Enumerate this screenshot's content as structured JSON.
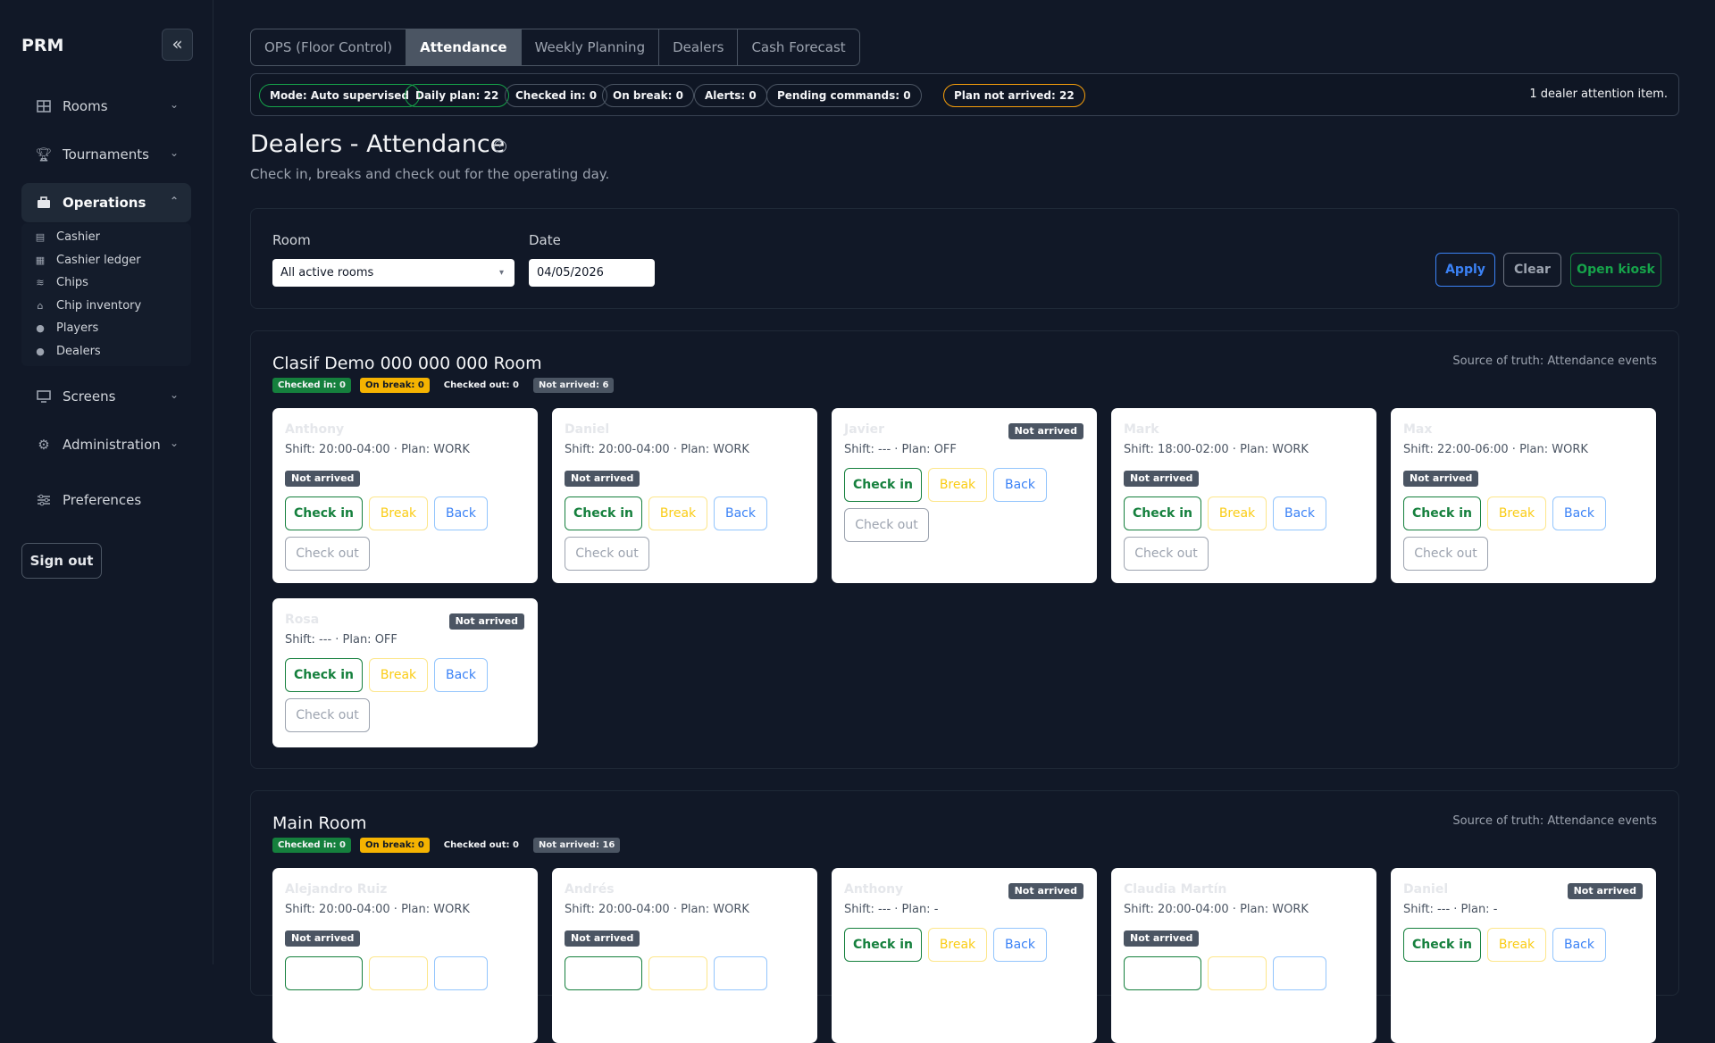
{
  "app": {
    "name": "PRM"
  },
  "sidebar": {
    "items": [
      {
        "label": "Rooms"
      },
      {
        "label": "Tournaments"
      },
      {
        "label": "Operations"
      },
      {
        "label": "Screens"
      },
      {
        "label": "Administration"
      },
      {
        "label": "Preferences"
      }
    ],
    "operations_sub": [
      {
        "label": "Cashier"
      },
      {
        "label": "Cashier ledger"
      },
      {
        "label": "Chips"
      },
      {
        "label": "Chip inventory"
      },
      {
        "label": "Players"
      },
      {
        "label": "Dealers"
      }
    ],
    "sign_out": "Sign out"
  },
  "tabs": [
    {
      "label": "OPS (Floor Control)"
    },
    {
      "label": "Attendance",
      "active": true
    },
    {
      "label": "Weekly Planning"
    },
    {
      "label": "Dealers"
    },
    {
      "label": "Cash Forecast"
    }
  ],
  "status": {
    "mode": "Mode: Auto supervised",
    "daily_plan": "Daily plan: 22",
    "checked_in": "Checked in: 0",
    "on_break": "On break: 0",
    "alerts": "Alerts: 0",
    "pending": "Pending commands: 0",
    "not_arrived": "Plan not arrived: 22",
    "attention": "1 dealer attention item."
  },
  "page": {
    "title": "Dealers - Attendance",
    "subtitle": "Check in, breaks and check out for the operating day."
  },
  "filters": {
    "room_label": "Room",
    "room_value": "All active rooms",
    "date_label": "Date",
    "date_value": "04/05/2026",
    "apply": "Apply",
    "clear": "Clear",
    "kiosk": "Open kiosk"
  },
  "labels": {
    "not_arrived": "Not arrived",
    "check_in": "Check in",
    "break": "Break",
    "back": "Back",
    "check_out": "Check out"
  },
  "rooms": [
    {
      "title": "Clasif Demo 000 000 000 Room",
      "source": "Source of truth: Attendance events",
      "badges": {
        "checked_in": "Checked in: 0",
        "on_break": "On break: 0",
        "checked_out": "Checked out: 0",
        "not_arrived": "Not arrived: 6"
      },
      "dealers": [
        {
          "name": "Anthony",
          "shift": "Shift: 20:00-04:00 · Plan: WORK"
        },
        {
          "name": "Daniel",
          "shift": "Shift: 20:00-04:00 · Plan: WORK"
        },
        {
          "name": "Javier",
          "shift": "Shift: --- · Plan: OFF"
        },
        {
          "name": "Mark",
          "shift": "Shift: 18:00-02:00 · Plan: WORK"
        },
        {
          "name": "Max",
          "shift": "Shift: 22:00-06:00 · Plan: WORK"
        },
        {
          "name": "Rosa",
          "shift": "Shift: --- · Plan: OFF"
        }
      ]
    },
    {
      "title": "Main Room",
      "source": "Source of truth: Attendance events",
      "badges": {
        "checked_in": "Checked in: 0",
        "on_break": "On break: 0",
        "checked_out": "Checked out: 0",
        "not_arrived": "Not arrived: 16"
      },
      "dealers": [
        {
          "name": "Alejandro Ruiz",
          "shift": "Shift: 20:00-04:00 · Plan: WORK"
        },
        {
          "name": "Andrés",
          "shift": "Shift: 20:00-04:00 · Plan: WORK"
        },
        {
          "name": "Anthony",
          "shift": "Shift: --- · Plan: -"
        },
        {
          "name": "Claudia Martín",
          "shift": "Shift: 20:00-04:00 · Plan: WORK"
        },
        {
          "name": "Daniel",
          "shift": "Shift: --- · Plan: -"
        }
      ]
    }
  ]
}
